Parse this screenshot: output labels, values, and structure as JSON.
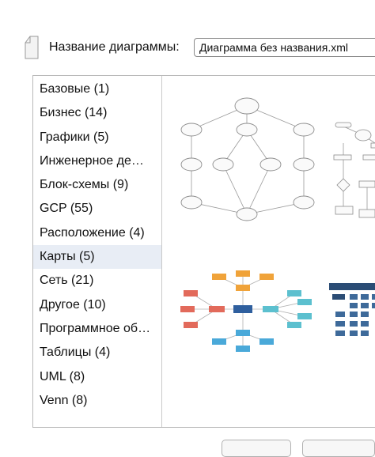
{
  "header": {
    "name_label": "Название диаграммы:",
    "file_name": "Диаграмма без названия.xml"
  },
  "categories": [
    {
      "label": "Базовые (1)"
    },
    {
      "label": "Бизнес (14)"
    },
    {
      "label": "Графики (5)"
    },
    {
      "label": "Инженерное де…"
    },
    {
      "label": "Блок-схемы (9)"
    },
    {
      "label": "GCP (55)"
    },
    {
      "label": "Расположение (4)"
    },
    {
      "label": "Карты (5)"
    },
    {
      "label": "Сеть (21)"
    },
    {
      "label": "Другое (10)"
    },
    {
      "label": "Программное об…"
    },
    {
      "label": "Таблицы (4)"
    },
    {
      "label": "UML (8)"
    },
    {
      "label": "Venn (8)"
    }
  ],
  "selected_category": "Карты (5)",
  "colors": {
    "selected_bg": "#e8edf5",
    "mind_center": "#2f5f9e",
    "mind_orange": "#f0a33a",
    "mind_red": "#e26a5b",
    "mind_teal": "#5cc0cf",
    "mind_blue": "#4aa9d9",
    "org_dark": "#2b4d75"
  }
}
